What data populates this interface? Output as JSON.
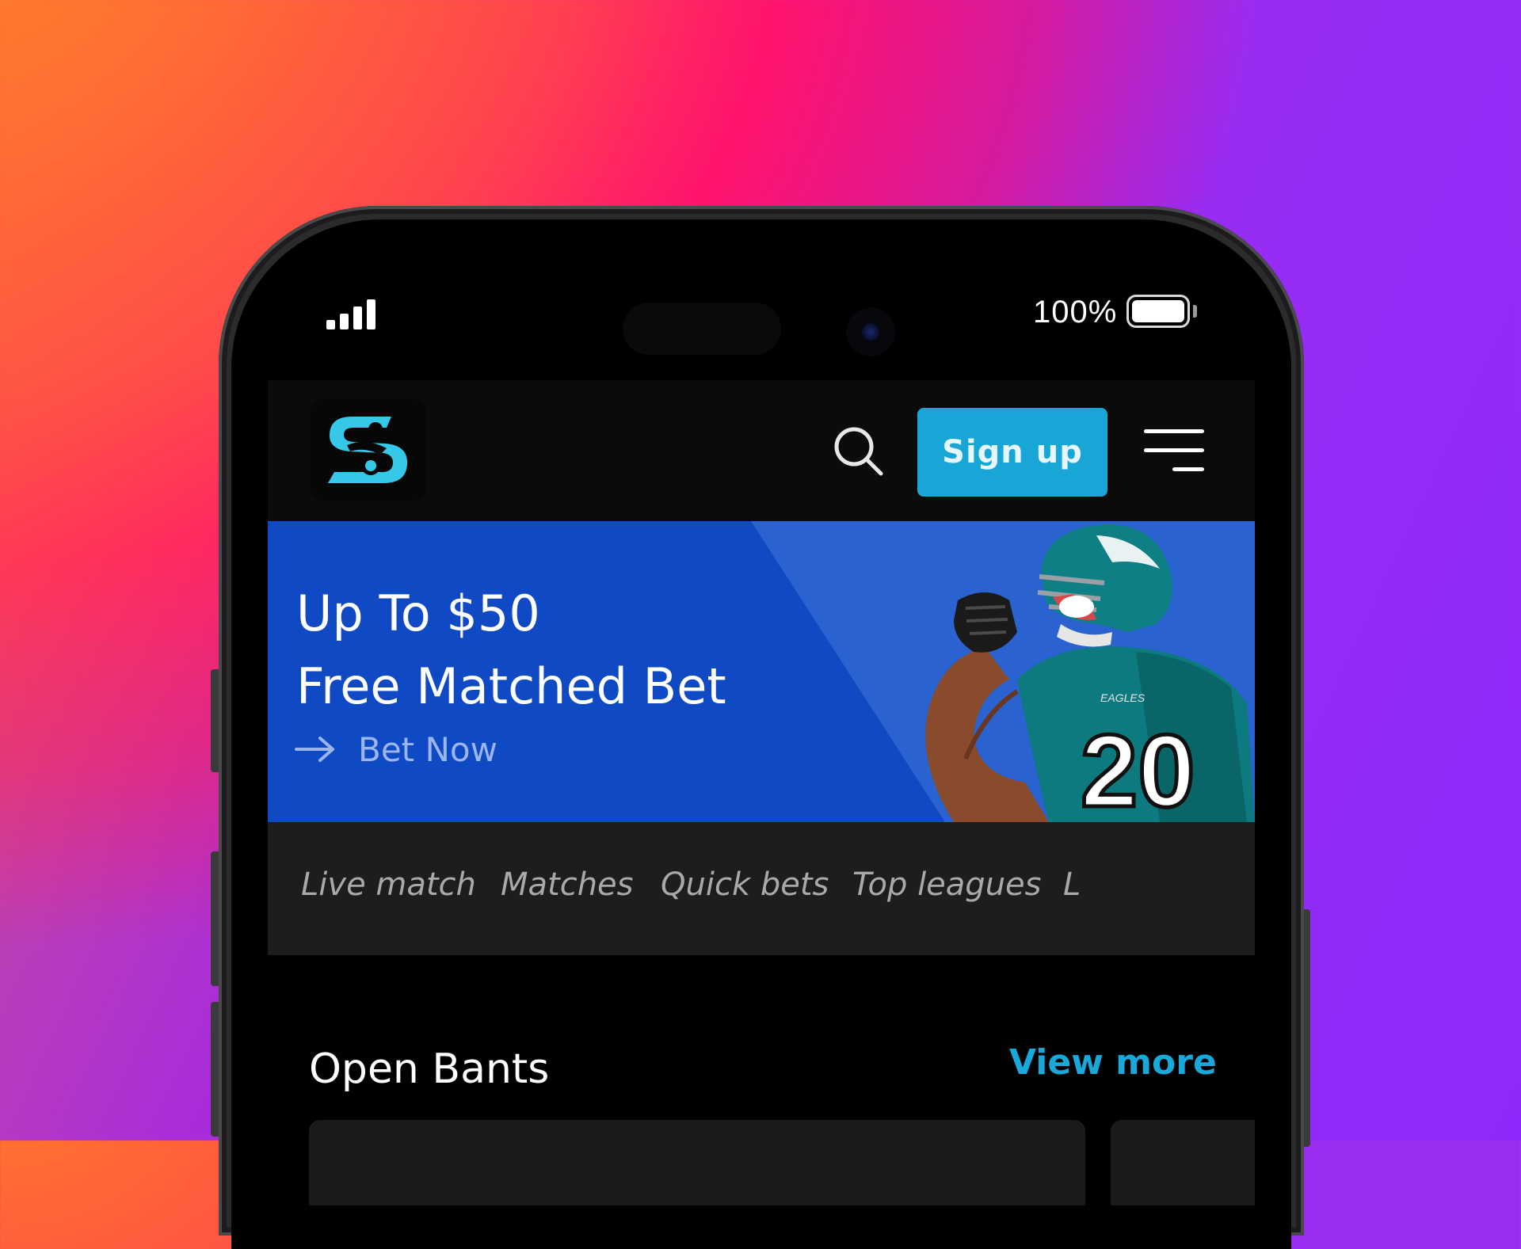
{
  "status_bar": {
    "battery_percent": "100%"
  },
  "header": {
    "logo_icon": "logo-s-player-icon",
    "search_icon": "search-icon",
    "signup_label": "Sign up",
    "menu_icon": "hamburger-menu-icon"
  },
  "banner": {
    "headline_line1": "Up To $50",
    "headline_line2": "Free Matched Bet",
    "cta_label": "Bet Now",
    "player_jersey_text": "20",
    "player_brand_text": "EAGLES"
  },
  "tabs": [
    {
      "label": "Live match"
    },
    {
      "label": "Matches"
    },
    {
      "label": "Quick bets"
    },
    {
      "label": "Top leagues"
    },
    {
      "label": "L"
    }
  ],
  "open_bants": {
    "title": "Open Bants",
    "view_more_label": "View more"
  },
  "colors": {
    "accent": "#17a6d6",
    "banner_blue": "#0f4ac4",
    "tab_bar": "#1d1d1d",
    "app_bg": "#000000"
  }
}
